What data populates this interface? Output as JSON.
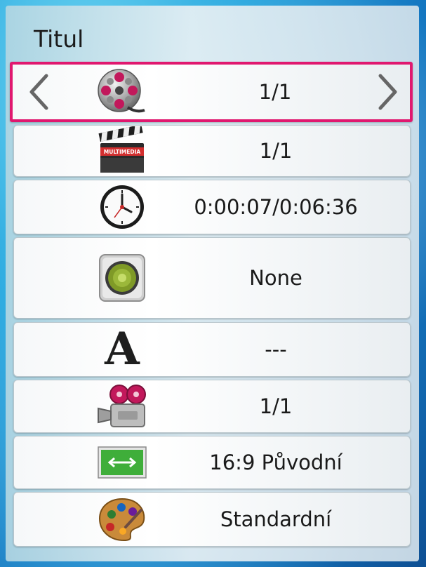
{
  "panel": {
    "title": "Titul"
  },
  "rows": [
    {
      "name": "title",
      "icon": "film-reel-icon",
      "value": "1/1",
      "selected": true
    },
    {
      "name": "chapter",
      "icon": "clapperboard-icon",
      "icon_text": "MULTIMEDIA",
      "value": "1/1"
    },
    {
      "name": "time",
      "icon": "clock-icon",
      "value": "0:00:07/0:06:36"
    },
    {
      "name": "audio",
      "icon": "speaker-icon",
      "value": "None"
    },
    {
      "name": "subtitle",
      "icon": "letter-a-icon",
      "icon_text": "A",
      "value": "---"
    },
    {
      "name": "angle",
      "icon": "video-camera-icon",
      "value": "1/1"
    },
    {
      "name": "aspect-ratio",
      "icon": "aspect-ratio-icon",
      "value": "16:9 Původní"
    },
    {
      "name": "picture-mode",
      "icon": "palette-icon",
      "value": "Standardní"
    }
  ],
  "colors": {
    "accent": "#e0186f"
  }
}
